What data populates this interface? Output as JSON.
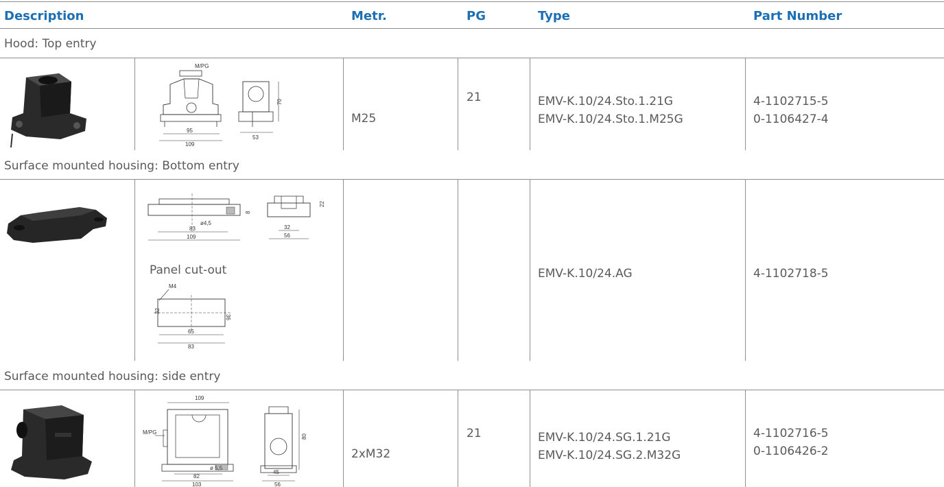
{
  "header": {
    "description": "Description",
    "metr": "Metr.",
    "pg": "PG",
    "type": "Type",
    "part_number": "Part Number"
  },
  "sections": [
    {
      "title": "Hood: Top entry",
      "metr": "M25",
      "pg": "21",
      "type_line1": "EMV-K.10/24.Sto.1.21G",
      "type_line2": "EMV-K.10/24.Sto.1.M25G",
      "part_line1": "4-1102715-5",
      "part_line2": "0-1106427-4",
      "dims": {
        "mpg": "M/PG",
        "d1": "95",
        "d2": "109",
        "d3": "70",
        "d4": "53"
      }
    },
    {
      "title": "Surface mounted housing: Bottom entry",
      "type": "EMV-K.10/24.AG",
      "part": "4-1102718-5",
      "panel_cutout": "Panel cut-out",
      "dims": {
        "d1": "ø4,5",
        "d2": "83",
        "d3": "109",
        "d4": "8",
        "d5": "22",
        "d6": "32",
        "d7": "56",
        "m4": "M4",
        "c1": "32",
        "c2": "36",
        "c3": "65",
        "c4": "83"
      }
    },
    {
      "title": "Surface mounted housing: side entry",
      "metr": "2xM32",
      "pg": "21",
      "type_line1": "EMV-K.10/24.SG.1.21G",
      "type_line2": "EMV-K.10/24.SG.2.M32G",
      "part_line1": "4-1102716-5",
      "part_line2": "0-1106426-2",
      "dims": {
        "mpg": "M/PG",
        "d1": "109",
        "d2": "82",
        "d3": "ø 5,5",
        "d4": "103",
        "d5": "45",
        "d6": "56",
        "d7": "80"
      }
    }
  ]
}
